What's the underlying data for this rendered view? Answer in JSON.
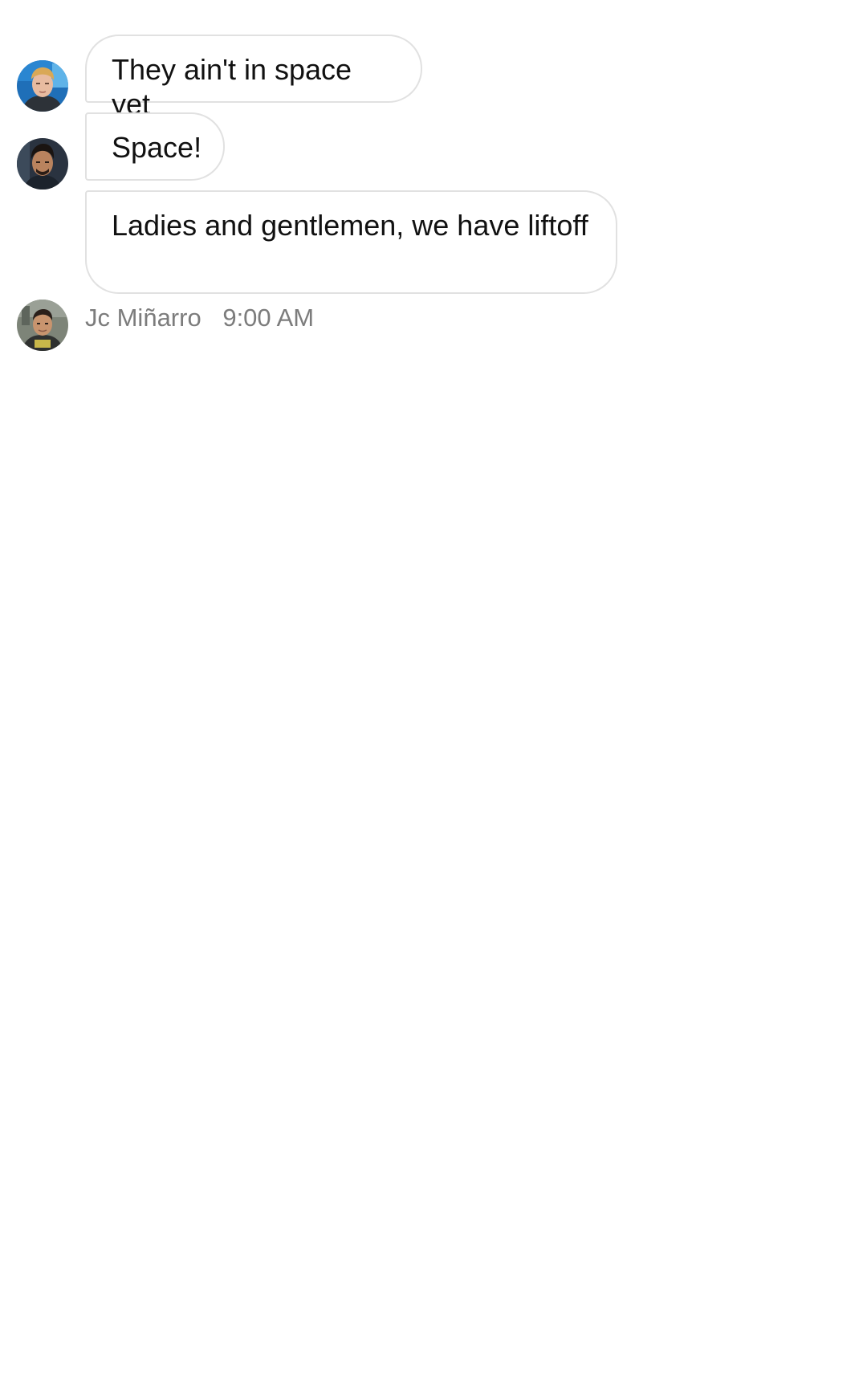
{
  "messages": [
    {
      "text": "They ain't in space yet"
    },
    {
      "text": "Space!"
    },
    {
      "text": "Ladies and gentlemen, we have liftoff"
    }
  ],
  "last_sender": {
    "name": "Jc Miñarro",
    "time": "9:00 AM"
  }
}
